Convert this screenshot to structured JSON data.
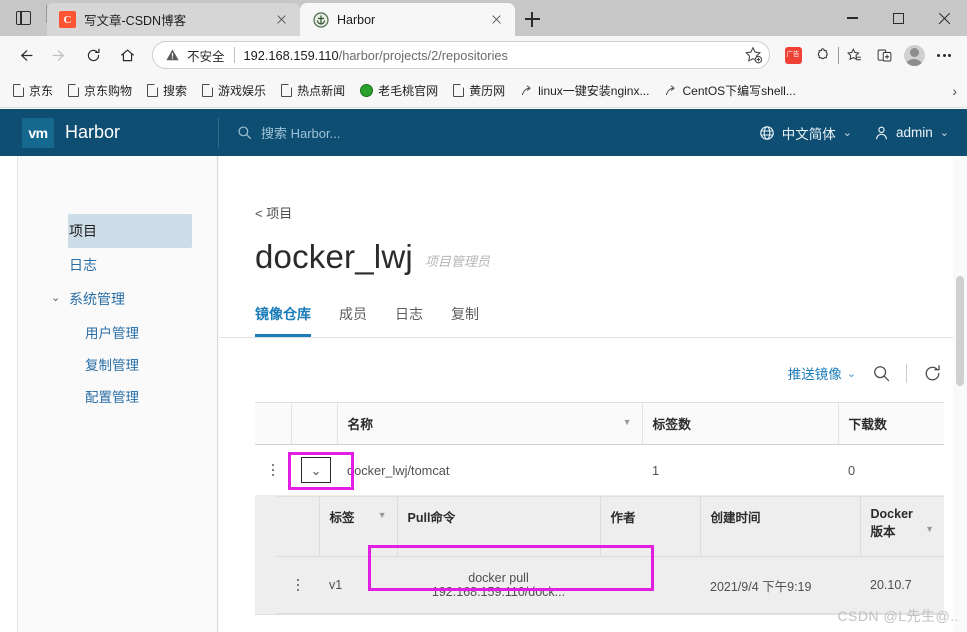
{
  "browser": {
    "tabs": [
      {
        "title": "写文章-CSDN博客",
        "favicon": "csdn-icon",
        "active": false,
        "close_label": "×"
      },
      {
        "title": "Harbor",
        "favicon": "harbor-icon",
        "active": true,
        "close_label": "×"
      }
    ],
    "new_tab_label": "+",
    "window_controls": {
      "minimize": "minimize-icon",
      "maximize": "maximize-icon",
      "close": "close-icon"
    },
    "nav": {
      "back": "back-arrow-icon",
      "forward": "forward-arrow-icon",
      "reload": "reload-icon",
      "home": "home-icon"
    },
    "address": {
      "security_label": "不安全",
      "url_host": "192.168.159.110",
      "url_path": "/harbor/projects/2/repositories",
      "bookmark_icon": "star-add-icon"
    },
    "toolbar_icons": [
      {
        "name": "extension-red-icon",
        "label": "广告"
      },
      {
        "name": "puzzle-extensions-icon"
      },
      {
        "name": "favorites-star-icon"
      },
      {
        "name": "collections-icon"
      },
      {
        "name": "profile-avatar-icon"
      },
      {
        "name": "more-options-icon"
      }
    ],
    "bookmarks": [
      {
        "label": "京东",
        "icon": "page-icon"
      },
      {
        "label": "京东购物",
        "icon": "page-icon"
      },
      {
        "label": "搜索",
        "icon": "page-icon"
      },
      {
        "label": "游戏娱乐",
        "icon": "page-icon"
      },
      {
        "label": "热点新闻",
        "icon": "page-icon"
      },
      {
        "label": "老毛桃官网",
        "icon": "globe-icon"
      },
      {
        "label": "黄历网",
        "icon": "page-icon"
      },
      {
        "label": "linux一键安装nginx...",
        "icon": "shortcut-icon"
      },
      {
        "label": "CentOS下编写shell...",
        "icon": "shortcut-icon"
      }
    ],
    "bookmarks_overflow": "›"
  },
  "harbor": {
    "brand": {
      "logo_text": "vm",
      "name": "Harbor"
    },
    "search_placeholder": "搜索 Harbor...",
    "search_icon": "search-icon",
    "language": {
      "label": "中文简体",
      "icon": "globe-icon",
      "caret": "⌄"
    },
    "user": {
      "label": "admin",
      "icon": "user-icon",
      "caret": "⌄"
    },
    "accent_color": "#0f4e73",
    "link_color": "#1b7cb8"
  },
  "sidebar": {
    "items": [
      {
        "label": "项目",
        "active": true,
        "type": "item"
      },
      {
        "label": "日志",
        "active": false,
        "type": "item"
      },
      {
        "label": "系统管理",
        "active": false,
        "type": "group",
        "caret": "⌄"
      },
      {
        "label": "用户管理",
        "active": false,
        "type": "sub"
      },
      {
        "label": "复制管理",
        "active": false,
        "type": "sub"
      },
      {
        "label": "配置管理",
        "active": false,
        "type": "sub"
      }
    ]
  },
  "main": {
    "breadcrumb": "< 项目",
    "project_name": "docker_lwj",
    "project_role": "项目管理员",
    "tabs": [
      {
        "label": "镜像仓库",
        "selected": true
      },
      {
        "label": "成员",
        "selected": false
      },
      {
        "label": "日志",
        "selected": false
      },
      {
        "label": "复制",
        "selected": false
      }
    ],
    "actions": {
      "push_image": "推送镜像",
      "push_caret": "⌄",
      "search_icon": "search-icon",
      "refresh_icon": "refresh-icon"
    },
    "repo_table": {
      "columns": [
        "",
        "",
        "名称",
        "标签数",
        "下载数"
      ],
      "filter_icon": "filter-icon",
      "rows": [
        {
          "kebab": "more-icon",
          "expand_caret": "⌄",
          "name": "docker_lwj/tomcat",
          "tag_count": "1",
          "download_count": "0"
        }
      ]
    },
    "tag_table": {
      "columns": [
        "",
        "标签",
        "Pull命令",
        "作者",
        "创建时间",
        "Docker 版本"
      ],
      "column_docker_version_line1": "Docker",
      "column_docker_version_line2": "版本",
      "filter_icon": "filter-icon",
      "rows": [
        {
          "kebab": "more-icon",
          "tag": "v1",
          "pull_command": "docker pull 192.168.159.110/dock...",
          "author": "",
          "created": "2021/9/4 下午9:19",
          "docker_version": "20.10.7"
        }
      ]
    }
  },
  "annotations": {
    "highlight_color": "#e31ee3",
    "boxes": [
      {
        "name": "expand-toggle-highlight"
      },
      {
        "name": "pull-command-highlight"
      }
    ]
  },
  "watermark": "CSDN @L先生@.."
}
